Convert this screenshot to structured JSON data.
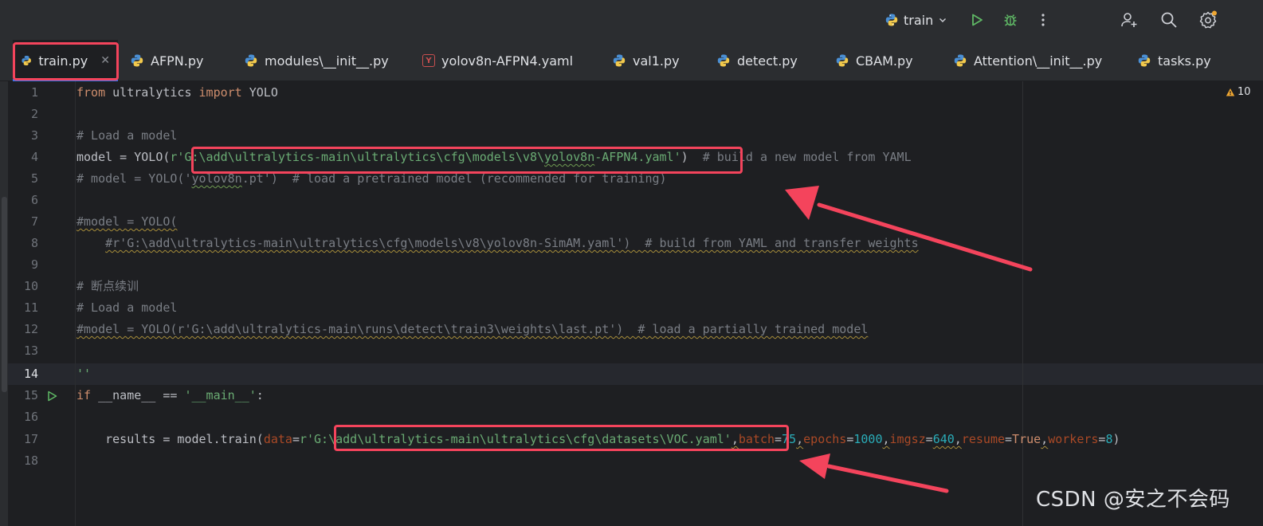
{
  "toolbar": {
    "run_config": "train"
  },
  "tabs": [
    {
      "label": "train.py",
      "type": "python",
      "active": true
    },
    {
      "label": "AFPN.py",
      "type": "python"
    },
    {
      "label": "modules\\__init__.py",
      "type": "python"
    },
    {
      "label": "yolov8n-AFPN4.yaml",
      "type": "yaml"
    },
    {
      "label": "val1.py",
      "type": "python"
    },
    {
      "label": "detect.py",
      "type": "python"
    },
    {
      "label": "CBAM.py",
      "type": "python"
    },
    {
      "label": "Attention\\__init__.py",
      "type": "python"
    },
    {
      "label": "tasks.py",
      "type": "python"
    }
  ],
  "editor": {
    "warning_count": "10",
    "current_line": 14,
    "line_numbers": [
      "1",
      "2",
      "3",
      "4",
      "5",
      "6",
      "7",
      "8",
      "9",
      "10",
      "11",
      "12",
      "13",
      "14",
      "15",
      "16",
      "17",
      "18"
    ],
    "lines": [
      "from ultralytics import YOLO",
      "",
      "# Load a model",
      "model = YOLO(r'G:\\add\\ultralytics-main\\ultralytics\\cfg\\models\\v8\\yolov8n-AFPN4.yaml')  # build a new model from YAML",
      "# model = YOLO('yolov8n.pt')  # load a pretrained model (recommended for training)",
      "",
      "#model = YOLO(",
      "    #r'G:\\add\\ultralytics-main\\ultralytics\\cfg\\models\\v8\\yolov8n-SimAM.yaml')  # build from YAML and transfer weights",
      "",
      "# 断点续训",
      "# Load a model",
      "#model = YOLO(r'G:\\add\\ultralytics-main\\runs\\detect\\train3\\weights\\last.pt')  # load a partially trained model",
      "",
      "''",
      "if __name__ == '__main__':",
      "",
      "    results = model.train(data=r'G:\\add\\ultralytics-main\\ultralytics\\cfg\\datasets\\VOC.yaml',batch=75,epochs=1000,imgsz=640,resume=True,workers=8)",
      ""
    ]
  },
  "code_tokens": {
    "l1_from": "from",
    "l1_mod": " ultralytics ",
    "l1_import": "import",
    "l1_name": " YOLO",
    "l3": "# Load a model",
    "l4_a": "model = YOLO(",
    "l4_b": "r'",
    "l4_path": "G:\\add\\ultralytics-main\\ultralytics\\cfg\\models\\v8\\",
    "l4_file": "yolov8n",
    "l4_rest": "-AFPN4.yaml'",
    "l4_close": ")",
    "l4_cmt": "  # build a new model from YAML",
    "l5_a": "# model = YOLO('",
    "l5_b": "yolov8n",
    "l5_c": ".pt')  # load a pretrained model (recommended for training)",
    "l7": "#model = YOLO(",
    "l8_indent": "    ",
    "l8": "#r'G:\\add\\ultralytics-main\\ultralytics\\cfg\\models\\v8\\yolov8n-SimAM.yaml')  # build from YAML and transfer weights",
    "l10": "# 断点续训",
    "l11": "# Load a model",
    "l12": "#model = YOLO(r'G:\\add\\ultralytics-main\\runs\\detect\\train3\\weights\\last.pt')  # load a partially trained model",
    "l14": "''",
    "l15_if": "if",
    "l15_mid": " __name__ == ",
    "l15_str": "'__main__'",
    "l15_end": ":",
    "l17_a": "    results = model.train(",
    "l17_data": "data",
    "l17_eq": "=",
    "l17_r": "r'",
    "l17_path": "G:\\add\\ultralytics-main\\ultralytics\\cfg\\datasets\\VOC.yaml'",
    "l17_c1": ",",
    "l17_batch": "batch",
    "l17_eq2": "=",
    "l17_75": "75",
    "l17_c2": ",",
    "l17_epochs": "epochs",
    "l17_eq3": "=",
    "l17_1000": "1000",
    "l17_c3": ",",
    "l17_imgsz": "imgsz",
    "l17_eq4": "=",
    "l17_640": "640",
    "l17_c4": ",",
    "l17_resume": "resume",
    "l17_eq5": "=",
    "l17_true": "True",
    "l17_c5": ",",
    "l17_workers": "workers",
    "l17_eq6": "=",
    "l17_8": "8",
    "l17_end": ")"
  },
  "watermark": "CSDN @安之不会码",
  "colors": {
    "keyword": "#cf8e6d",
    "string": "#6aab73",
    "comment": "#7a7e85",
    "number": "#2aacb8",
    "param": "#aa4926",
    "highlight": "#f4445c",
    "tab_underline": "#3574f0"
  },
  "icons": [
    "python-icon",
    "yaml-icon",
    "run-icon",
    "debug-icon",
    "more-icon",
    "add-user-icon",
    "search-icon",
    "settings-icon",
    "warning-icon",
    "chevron-down-icon",
    "close-icon"
  ]
}
